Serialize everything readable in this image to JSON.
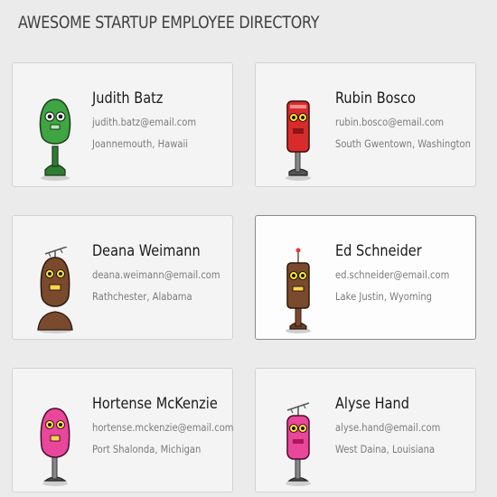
{
  "page": {
    "title": "AWESOME STARTUP EMPLOYEE DIRECTORY"
  },
  "employees": [
    {
      "name": "Judith Batz",
      "email": "judith.batz@email.com",
      "location": "Joannemouth, Hawaii",
      "avatar_icon": "green-robot-icon",
      "color": "#3fa542",
      "selected": false
    },
    {
      "name": "Rubin Bosco",
      "email": "rubin.bosco@email.com",
      "location": "South Gwentown, Washington",
      "avatar_icon": "red-robot-icon",
      "color": "#d92b2b",
      "selected": false
    },
    {
      "name": "Deana Weimann",
      "email": "deana.weimann@email.com",
      "location": "Rathchester, Alabama",
      "avatar_icon": "brown-antenna-robot-icon",
      "color": "#7a4a2e",
      "selected": false
    },
    {
      "name": "Ed Schneider",
      "email": "ed.schneider@email.com",
      "location": "Lake Justin, Wyoming",
      "avatar_icon": "brown-robot-icon",
      "color": "#7a4a2e",
      "selected": true
    },
    {
      "name": "Hortense McKenzie",
      "email": "hortense.mckenzie@email.com",
      "location": "Port Shalonda, Michigan",
      "avatar_icon": "pink-robot-icon",
      "color": "#e8479b",
      "selected": false
    },
    {
      "name": "Alyse Hand",
      "email": "alyse.hand@email.com",
      "location": "West Daina, Louisiana",
      "avatar_icon": "pink-antenna-robot-icon",
      "color": "#e8479b",
      "selected": false
    }
  ]
}
